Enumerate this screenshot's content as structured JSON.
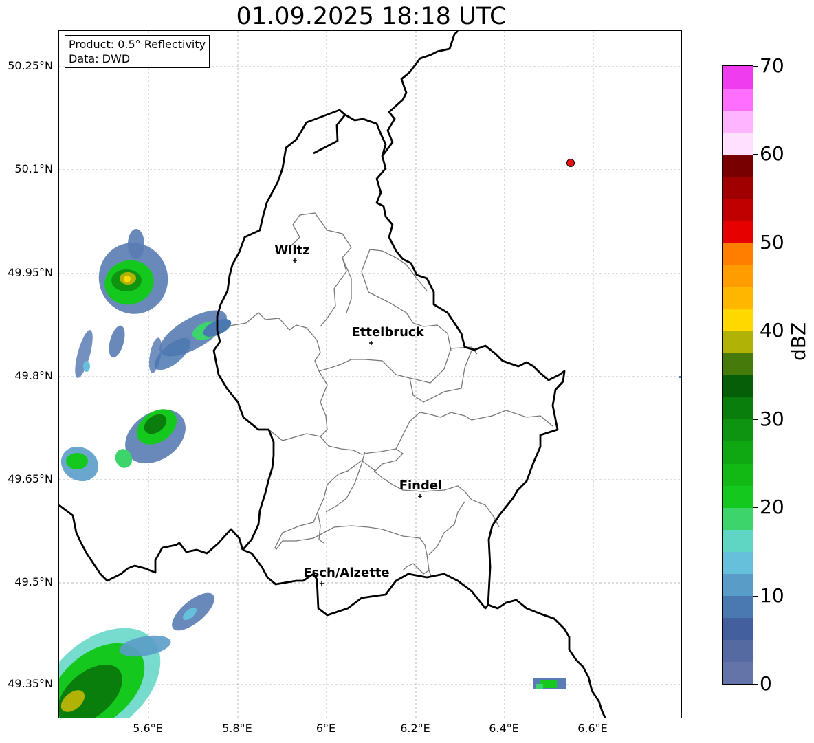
{
  "title": "01.09.2025 18:18 UTC",
  "info": {
    "product": "Product: 0.5° Reflectivity",
    "source": "Data: DWD"
  },
  "lat_ticks": [
    "50.25°N",
    "50.1°N",
    "49.95°N",
    "49.8°N",
    "49.65°N",
    "49.5°N",
    "49.35°N"
  ],
  "lon_ticks": [
    "5.6°E",
    "5.8°E",
    "6°E",
    "6.2°E",
    "6.4°E",
    "6.6°E"
  ],
  "colorbar": {
    "label": "dBZ",
    "ticks": [
      "0",
      "10",
      "20",
      "30",
      "40",
      "50",
      "60",
      "70"
    ],
    "min": 0,
    "max": 70,
    "step": 2.5,
    "colors": [
      "#6474a8",
      "#566aa2",
      "#445f9e",
      "#4a78b0",
      "#5a9cc8",
      "#66c0dc",
      "#5fd6c4",
      "#3ed46c",
      "#14c81e",
      "#12b814",
      "#10a812",
      "#0e9410",
      "#0a7e0c",
      "#065e08",
      "#467a0a",
      "#b0b206",
      "#ffd800",
      "#ffb600",
      "#ff9c00",
      "#ff7e00",
      "#e60000",
      "#c00000",
      "#a00000",
      "#780000",
      "#ffe0ff",
      "#ffb4ff",
      "#ff6eff",
      "#ee3cee"
    ]
  },
  "cities": [
    {
      "name": "Wiltz"
    },
    {
      "name": "Ettelbruck"
    },
    {
      "name": "Findel"
    },
    {
      "name": "Esch/Alzette"
    }
  ],
  "marker": {
    "color": "#ee1111"
  }
}
